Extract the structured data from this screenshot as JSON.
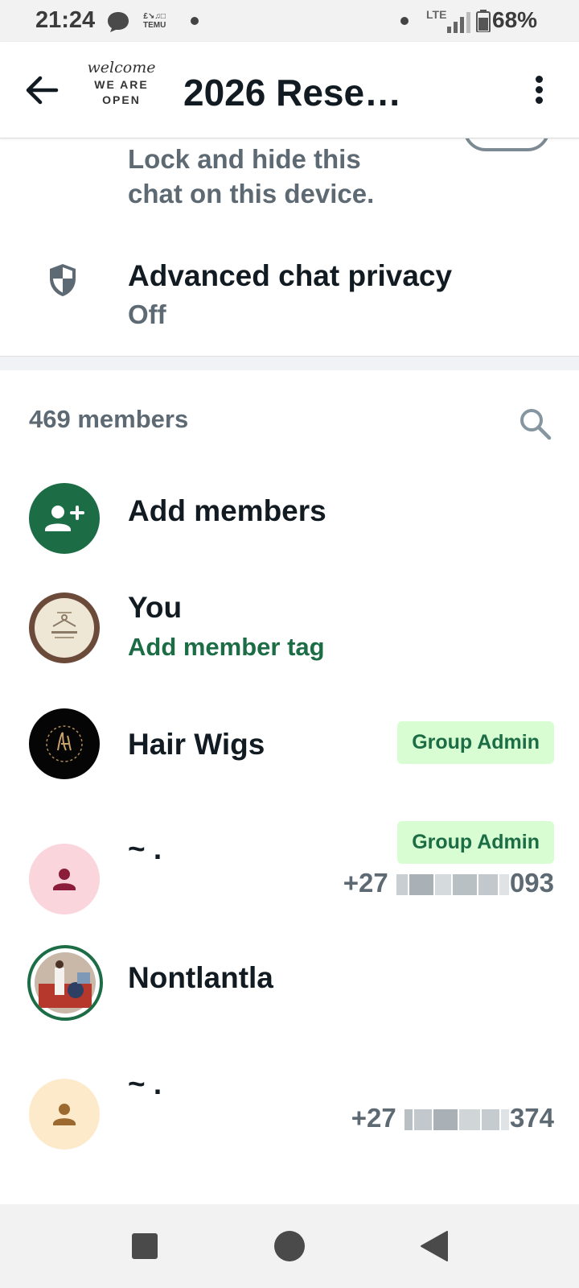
{
  "status_bar": {
    "time": "21:24",
    "temu_line1": "£↘♫□",
    "temu_line2": "TEMU",
    "network": "LTE",
    "battery": "68%"
  },
  "header": {
    "group_avatar": {
      "script": "welcome",
      "line1": "WE ARE",
      "line2": "OPEN"
    },
    "title": "2026 Rese…"
  },
  "lock_setting": {
    "description": "Lock and hide this chat on this device."
  },
  "privacy_setting": {
    "title": "Advanced chat privacy",
    "value": "Off"
  },
  "members": {
    "count_label": "469 members",
    "add_label": "Add members",
    "list": [
      {
        "name": "You",
        "subtitle": "Add member tag"
      },
      {
        "name": "Hair Wigs",
        "badge": "Group Admin"
      },
      {
        "name": "~ .",
        "badge": "Group Admin",
        "phone_prefix": "+27",
        "phone_suffix": "093"
      },
      {
        "name": "Nontlantla"
      },
      {
        "name": "~ .",
        "phone_prefix": "+27",
        "phone_suffix": "374"
      }
    ]
  },
  "colors": {
    "accent_green": "#1c6d46",
    "badge_bg": "#d8fdd2",
    "muted_text": "#5d6a73",
    "avatar_pink": "#fbd5dc",
    "avatar_peach": "#fdeacb"
  }
}
